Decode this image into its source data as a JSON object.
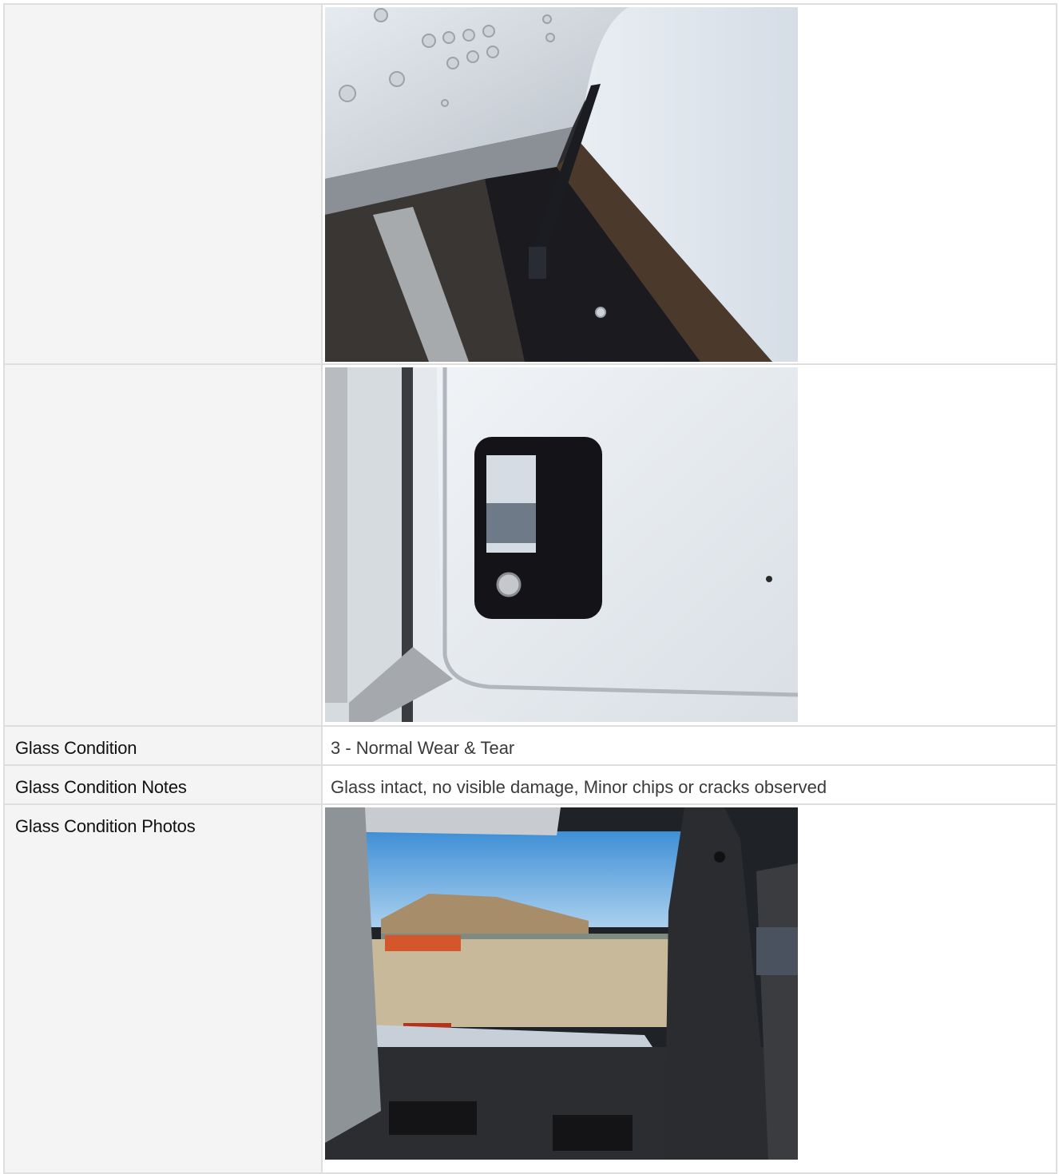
{
  "rows": {
    "glass_condition": {
      "label": "Glass Condition",
      "value": "3 - Normal Wear & Tear"
    },
    "glass_condition_notes": {
      "label": "Glass Condition Notes",
      "value": "Glass intact, no visible damage, Minor chips or cracks observed"
    },
    "glass_condition_photos": {
      "label": "Glass Condition Photos"
    }
  },
  "photos": [
    {
      "subject": "door-hinge"
    },
    {
      "subject": "door-handle"
    },
    {
      "subject": "windshield-view"
    }
  ],
  "colors": {
    "label_bg": "#f4f4f4",
    "border": "#dedede",
    "label_text": "#111111",
    "value_text": "#3a3a3a"
  }
}
